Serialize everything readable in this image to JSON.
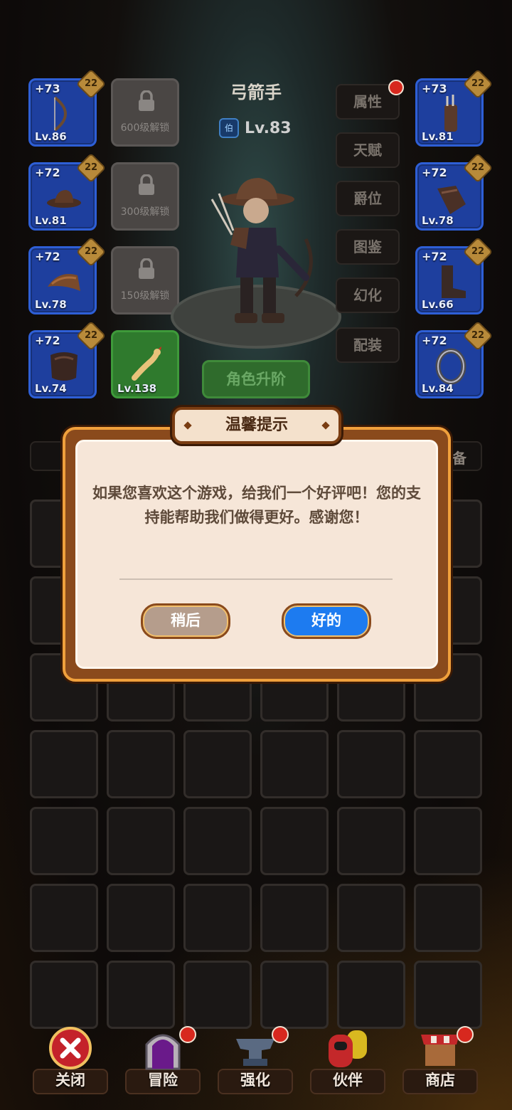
{
  "character": {
    "name": "弓箭手",
    "rank_label": "伯",
    "level": "Lv.83"
  },
  "left_slots": [
    {
      "plus": "+73",
      "badge": "22",
      "level": "Lv.86",
      "icon": "bow-icon"
    },
    {
      "plus": "+72",
      "badge": "22",
      "level": "Lv.81",
      "icon": "hat-icon"
    },
    {
      "plus": "+72",
      "badge": "22",
      "level": "Lv.78",
      "icon": "shoulder-armor-icon"
    },
    {
      "plus": "+72",
      "badge": "22",
      "level": "Lv.74",
      "icon": "chest-armor-icon"
    }
  ],
  "locked_slots": [
    {
      "label": "600级解锁"
    },
    {
      "label": "300级解锁"
    },
    {
      "label": "150级解锁"
    }
  ],
  "pet_slot": {
    "level": "Lv.138",
    "icon": "rubber-chicken-icon"
  },
  "right_slots": [
    {
      "plus": "+73",
      "badge": "22",
      "level": "Lv.81",
      "icon": "quiver-icon"
    },
    {
      "plus": "+72",
      "badge": "22",
      "level": "Lv.78",
      "icon": "gauntlet-icon"
    },
    {
      "plus": "+72",
      "badge": "22",
      "level": "Lv.66",
      "icon": "boots-icon"
    },
    {
      "plus": "+72",
      "badge": "22",
      "level": "Lv.84",
      "icon": "ring-icon"
    }
  ],
  "side_menu": [
    {
      "label": "属性",
      "notify": true
    },
    {
      "label": "天赋",
      "notify": false
    },
    {
      "label": "爵位",
      "notify": false
    },
    {
      "label": "图鉴",
      "notify": false
    },
    {
      "label": "幻化",
      "notify": false
    },
    {
      "label": "配装",
      "notify": false
    }
  ],
  "advance_button": "角色升阶",
  "tab_bar": {
    "left_partial": "",
    "right_partial": "备"
  },
  "dialog": {
    "title": "温馨提示",
    "message": "如果您喜欢这个游戏，给我们一个好评吧！您的支持能帮助我们做得更好。感谢您！",
    "later_button": "稍后",
    "ok_button": "好的"
  },
  "bottom_nav": [
    {
      "label": "关闭",
      "icon": "close-icon",
      "notify": false
    },
    {
      "label": "冒险",
      "icon": "portal-icon",
      "notify": true
    },
    {
      "label": "强化",
      "icon": "anvil-icon",
      "notify": true
    },
    {
      "label": "伙伴",
      "icon": "partners-icon",
      "notify": false
    },
    {
      "label": "商店",
      "icon": "shop-icon",
      "notify": true
    }
  ],
  "colors": {
    "equip_slot_blue": "#1e3f9e",
    "pet_slot_green": "#2f7a2d",
    "dialog_border": "#f0a03c",
    "ok_button_blue": "#1d7bf0",
    "later_button": "#b59d8c",
    "notify_red": "#d7281e"
  }
}
